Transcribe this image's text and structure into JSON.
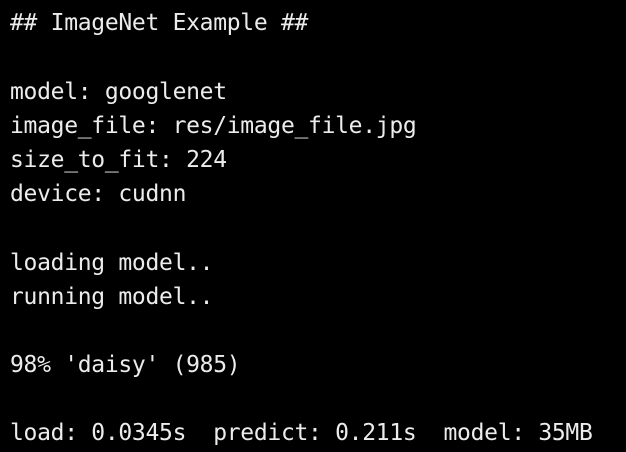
{
  "terminal": {
    "header": "## ImageNet Example ##",
    "config": {
      "model": "model: googlenet",
      "image_file": "image_file: res/image_file.jpg",
      "size_to_fit": "size_to_fit: 224",
      "device": "device: cudnn"
    },
    "progress": {
      "loading": "loading model..",
      "running": "running model.."
    },
    "result": "98% 'daisy' (985)",
    "timing": "load: 0.0345s  predict: 0.211s  model: 35MB",
    "colors": {
      "background": "#000000",
      "text": "#ececec"
    }
  }
}
